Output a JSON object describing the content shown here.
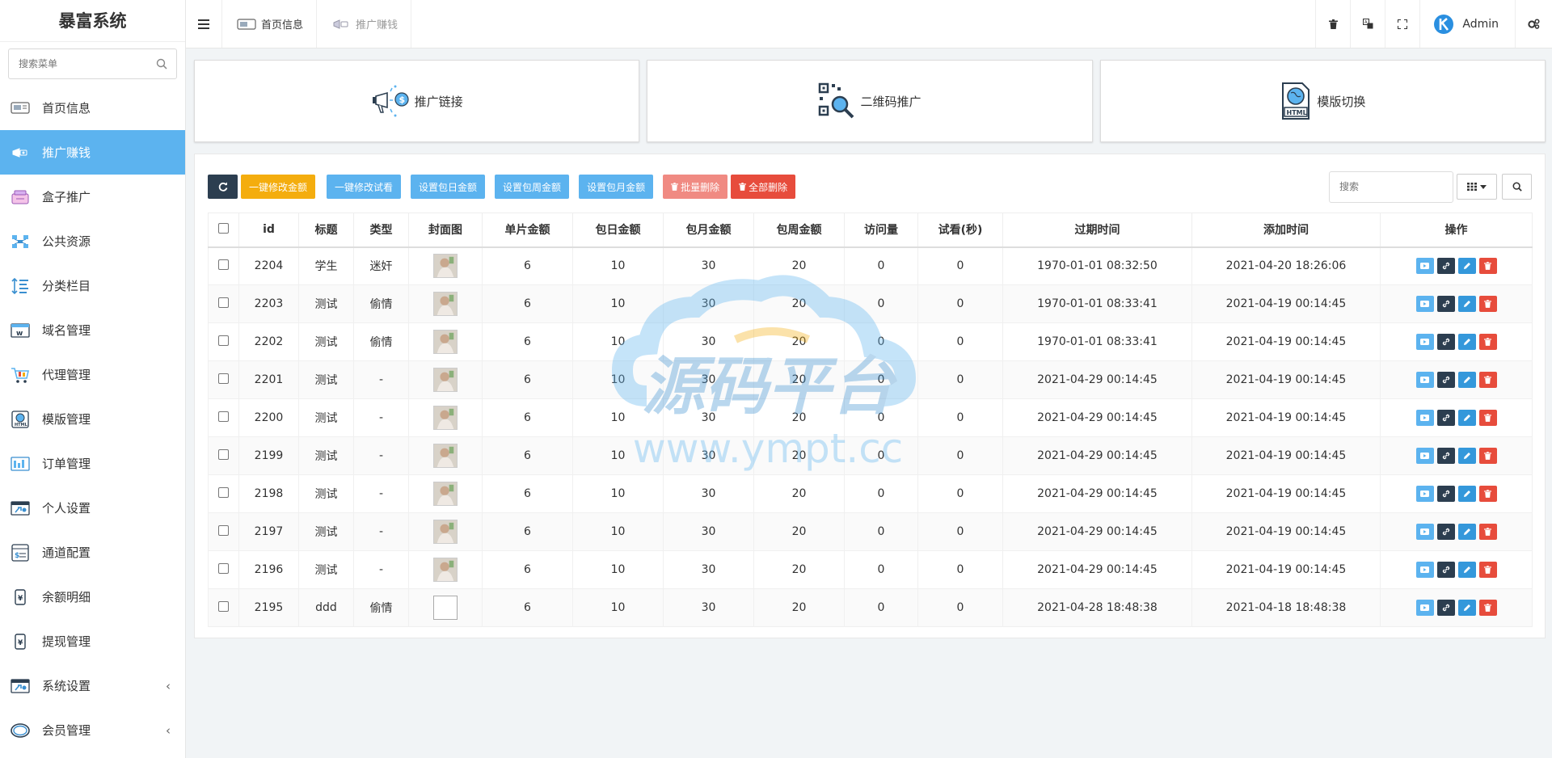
{
  "sidebar": {
    "brand": "暴富系统",
    "search_placeholder": "搜索菜单",
    "items": [
      {
        "label": "首页信息"
      },
      {
        "label": "推广赚钱"
      },
      {
        "label": "盒子推广"
      },
      {
        "label": "公共资源"
      },
      {
        "label": "分类栏目"
      },
      {
        "label": "域名管理"
      },
      {
        "label": "代理管理"
      },
      {
        "label": "模版管理"
      },
      {
        "label": "订单管理"
      },
      {
        "label": "个人设置"
      },
      {
        "label": "通道配置"
      },
      {
        "label": "余额明细"
      },
      {
        "label": "提现管理"
      },
      {
        "label": "系统设置"
      },
      {
        "label": "会员管理"
      }
    ]
  },
  "topbar": {
    "tabs": [
      {
        "label": "首页信息"
      },
      {
        "label": "推广赚钱"
      }
    ],
    "user": "Admin"
  },
  "cards": [
    {
      "label": "推广链接"
    },
    {
      "label": "二维码推广"
    },
    {
      "label": "模版切换"
    }
  ],
  "toolbar": {
    "btn1": "一键修改金额",
    "btn2": "一键修改试看",
    "btn3": "设置包日金额",
    "btn4": "设置包周金额",
    "btn5": "设置包月金额",
    "btn6": "批量删除",
    "btn7": "全部删除",
    "search_placeholder": "搜索"
  },
  "table": {
    "headers": [
      "id",
      "标题",
      "类型",
      "封面图",
      "单片金额",
      "包日金额",
      "包月金额",
      "包周金额",
      "访问量",
      "试看(秒)",
      "过期时间",
      "添加时间",
      "操作"
    ],
    "rows": [
      {
        "id": "2204",
        "title": "学生",
        "type": "迷奸",
        "single": "6",
        "day": "10",
        "month": "30",
        "week": "20",
        "visits": "0",
        "trial": "0",
        "expire": "1970-01-01 08:32:50",
        "added": "2021-04-20 18:26:06"
      },
      {
        "id": "2203",
        "title": "测试",
        "type": "偷情",
        "single": "6",
        "day": "10",
        "month": "30",
        "week": "20",
        "visits": "0",
        "trial": "0",
        "expire": "1970-01-01 08:33:41",
        "added": "2021-04-19 00:14:45"
      },
      {
        "id": "2202",
        "title": "测试",
        "type": "偷情",
        "single": "6",
        "day": "10",
        "month": "30",
        "week": "20",
        "visits": "0",
        "trial": "0",
        "expire": "1970-01-01 08:33:41",
        "added": "2021-04-19 00:14:45"
      },
      {
        "id": "2201",
        "title": "测试",
        "type": "-",
        "single": "6",
        "day": "10",
        "month": "30",
        "week": "20",
        "visits": "0",
        "trial": "0",
        "expire": "2021-04-29 00:14:45",
        "added": "2021-04-19 00:14:45"
      },
      {
        "id": "2200",
        "title": "测试",
        "type": "-",
        "single": "6",
        "day": "10",
        "month": "30",
        "week": "20",
        "visits": "0",
        "trial": "0",
        "expire": "2021-04-29 00:14:45",
        "added": "2021-04-19 00:14:45"
      },
      {
        "id": "2199",
        "title": "测试",
        "type": "-",
        "single": "6",
        "day": "10",
        "month": "30",
        "week": "20",
        "visits": "0",
        "trial": "0",
        "expire": "2021-04-29 00:14:45",
        "added": "2021-04-19 00:14:45"
      },
      {
        "id": "2198",
        "title": "测试",
        "type": "-",
        "single": "6",
        "day": "10",
        "month": "30",
        "week": "20",
        "visits": "0",
        "trial": "0",
        "expire": "2021-04-29 00:14:45",
        "added": "2021-04-19 00:14:45"
      },
      {
        "id": "2197",
        "title": "测试",
        "type": "-",
        "single": "6",
        "day": "10",
        "month": "30",
        "week": "20",
        "visits": "0",
        "trial": "0",
        "expire": "2021-04-29 00:14:45",
        "added": "2021-04-19 00:14:45"
      },
      {
        "id": "2196",
        "title": "测试",
        "type": "-",
        "single": "6",
        "day": "10",
        "month": "30",
        "week": "20",
        "visits": "0",
        "trial": "0",
        "expire": "2021-04-29 00:14:45",
        "added": "2021-04-19 00:14:45"
      },
      {
        "id": "2195",
        "title": "ddd",
        "type": "偷情",
        "single": "6",
        "day": "10",
        "month": "30",
        "week": "20",
        "visits": "0",
        "trial": "0",
        "expire": "2021-04-28 18:48:38",
        "added": "2021-04-18 18:48:38"
      }
    ]
  },
  "watermark": {
    "title": "源码平台",
    "url": "www.ympt.cc"
  },
  "colors": {
    "accent": "#5cb3ef",
    "dark": "#2c3e50",
    "warning": "#f4ad0e",
    "danger": "#e74c3c"
  }
}
